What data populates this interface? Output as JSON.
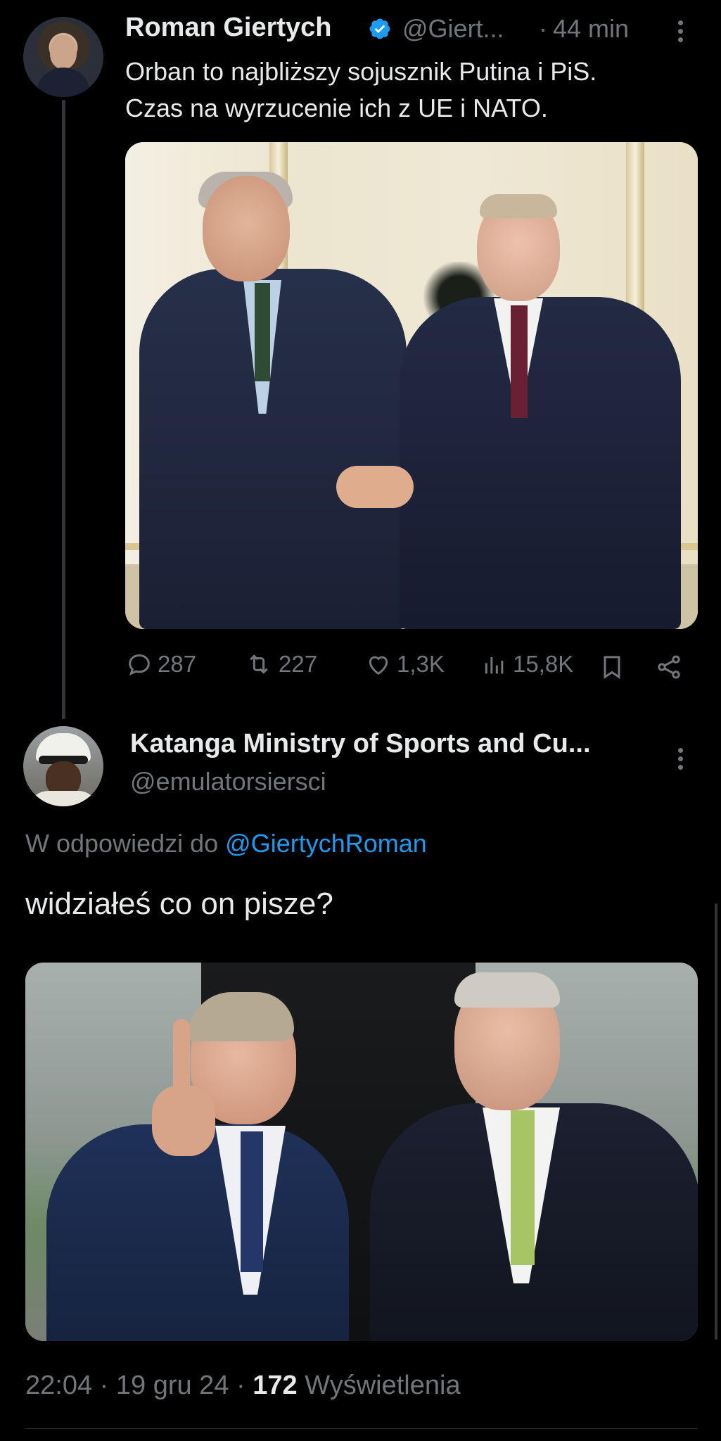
{
  "tweet": {
    "author_name": "Roman Giertych",
    "handle": "@Giert...",
    "time_sep": "·",
    "time": "44 min",
    "text_lines": [
      "Orban to najbliższy sojusznik Putina i PiS.",
      "Czas na wyrzucenie ich z UE i NATO."
    ],
    "stats": {
      "replies": "287",
      "reposts": "227",
      "likes": "1,3K",
      "views": "15,8K"
    }
  },
  "reply": {
    "author_name": "Katanga Ministry of Sports and Cu...",
    "handle": "@emulatorsiersci",
    "reply_to_prefix": "W odpowiedzi do ",
    "reply_to_handle": "@GiertychRoman",
    "text": "widziałeś co on pisze?",
    "footer": {
      "time": "22:04",
      "date": "19 gru 24",
      "views_count": "172",
      "views_label": "Wyświetlenia"
    }
  },
  "colors": {
    "background": "#000000",
    "text": "#e7e9ea",
    "muted": "#71767b",
    "link": "#1d9bf0",
    "verified": "#1d9bf0"
  }
}
